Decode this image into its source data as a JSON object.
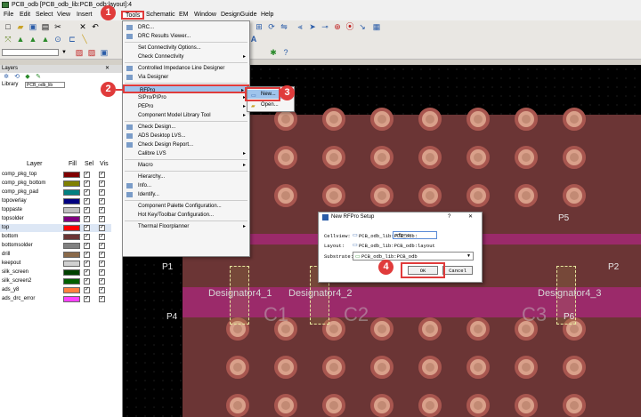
{
  "window": {
    "title": "PCB_odb [PCB_odb_lib:PCB_odb:layout]:4"
  },
  "menubar": [
    "File",
    "Edit",
    "Select",
    "View",
    "Insert",
    "Tools",
    "Schematic",
    "EM",
    "Window",
    "DesignGuide",
    "Help"
  ],
  "layers_panel": {
    "title": "Layers",
    "library_label": "Library",
    "library_value": "PCB_odb_lib",
    "columns": {
      "layer": "Layer",
      "fill": "Fill",
      "sel": "Sel",
      "vis": "Vis"
    },
    "rows": [
      {
        "name": "comp_pkg_top",
        "color": "#800000"
      },
      {
        "name": "comp_pkg_bottom",
        "color": "#808000"
      },
      {
        "name": "comp_pkg_pad",
        "color": "#008080"
      },
      {
        "name": "topoverlay",
        "color": "#000080"
      },
      {
        "name": "toppaste",
        "color": "#c0c0c0"
      },
      {
        "name": "topsolder",
        "color": "#800080"
      },
      {
        "name": "top",
        "color": "#ff0000"
      },
      {
        "name": "bottom",
        "color": "#6b3535"
      },
      {
        "name": "bottomsolder",
        "color": "#808080"
      },
      {
        "name": "drill",
        "color": "#8a6a4a"
      },
      {
        "name": "keepout",
        "color": "#d0d0d0"
      },
      {
        "name": "silk_screen",
        "color": "#004000"
      },
      {
        "name": "silk_screen2",
        "color": "#006000"
      },
      {
        "name": "ads_y8",
        "color": "#ff8040"
      },
      {
        "name": "ads_drc_error",
        "color": "#ff40ff"
      }
    ]
  },
  "tools_menu": {
    "items": [
      {
        "label": "DRC...",
        "icon": "drc-icon",
        "arrow": false
      },
      {
        "label": "DRC Results Viewer...",
        "icon": "drc-viewer-icon",
        "arrow": false
      },
      {
        "sep": true
      },
      {
        "label": "Set Connectivity Options...",
        "icon": "",
        "arrow": false
      },
      {
        "label": "Check Connectivity",
        "icon": "",
        "arrow": true
      },
      {
        "sep": true
      },
      {
        "label": "Controlled Impedance Line Designer",
        "icon": "impedance-icon",
        "arrow": false
      },
      {
        "label": "Via Designer",
        "icon": "via-icon",
        "arrow": false
      },
      {
        "sep": true
      },
      {
        "label": "RFPro",
        "icon": "",
        "arrow": true,
        "highlight": true
      },
      {
        "label": "SIPro/PIPro",
        "icon": "",
        "arrow": true
      },
      {
        "label": "PEPro",
        "icon": "",
        "arrow": true
      },
      {
        "label": "Component Model Library Tool",
        "icon": "",
        "arrow": true
      },
      {
        "sep": true
      },
      {
        "label": "Check Design...",
        "icon": "check-icon",
        "arrow": false
      },
      {
        "label": "ADS Desktop LVS...",
        "icon": "lvs-icon",
        "arrow": false
      },
      {
        "label": "Check Design Report...",
        "icon": "report-icon",
        "arrow": false
      },
      {
        "label": "Calibre LVS",
        "icon": "",
        "arrow": true
      },
      {
        "sep": true
      },
      {
        "label": "Macro",
        "icon": "",
        "arrow": true
      },
      {
        "sep": true
      },
      {
        "label": "Hierarchy...",
        "icon": "",
        "arrow": false
      },
      {
        "label": "Info...",
        "icon": "info-icon",
        "arrow": false
      },
      {
        "label": "Identify...",
        "icon": "identify-icon",
        "arrow": false
      },
      {
        "sep": true
      },
      {
        "label": "Component Palette Configuration...",
        "icon": "",
        "arrow": false
      },
      {
        "label": "Hot Key/Toolbar Configuration...",
        "icon": "",
        "arrow": false
      },
      {
        "sep": true
      },
      {
        "label": "Thermal Floorplanner",
        "icon": "",
        "arrow": true
      }
    ]
  },
  "rfpro_submenu": {
    "new": "New...",
    "open": "Open..."
  },
  "callouts": [
    "1",
    "2",
    "3",
    "4"
  ],
  "dialog": {
    "title": "New RFPro Setup",
    "help": "?",
    "close": "✕",
    "cellview_label": "Cellview:",
    "cellview_value": "PCB_odb_lib:PCB_odb:",
    "cellview_input": "rfpro",
    "layout_label": "Layout:",
    "layout_value": "PCB_odb_lib:PCB_odb:layout",
    "substrate_label": "Substrate:",
    "substrate_value": "PCB_odb_lib:PCB_odb",
    "ok": "OK",
    "cancel": "Cancel"
  },
  "canvas": {
    "ports": [
      "P1",
      "P2",
      "P4",
      "P5",
      "P6"
    ],
    "designators": [
      "Designator4_1",
      "Designator4_2",
      "Designator4_3"
    ],
    "components": [
      "C1",
      "C2",
      "C3"
    ]
  },
  "colors": {
    "accent": "#e03b3b",
    "highlight": "#9fc4ec",
    "board": "#6b3535",
    "strip": "#9b2a6a"
  }
}
